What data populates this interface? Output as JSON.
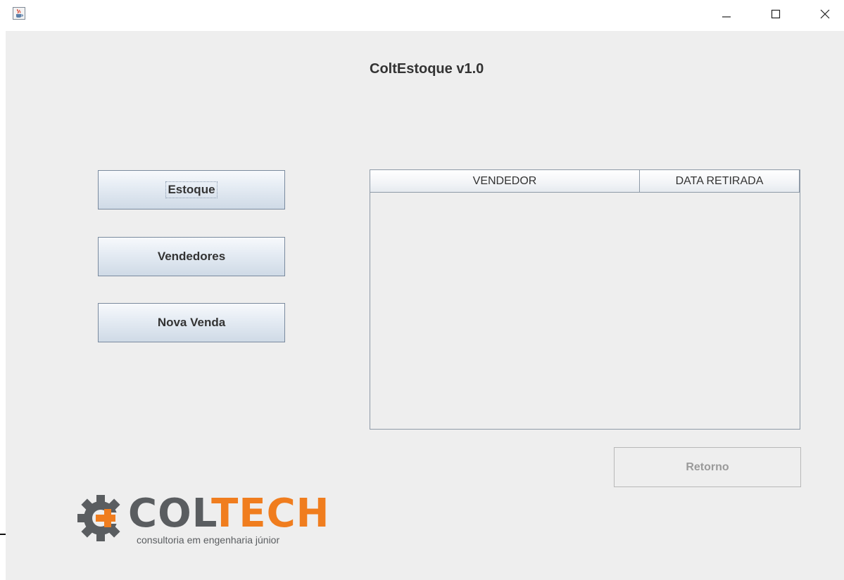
{
  "window": {
    "controls": {
      "minimize_icon": "minimize-icon",
      "maximize_icon": "maximize-icon",
      "close_icon": "close-icon"
    },
    "app_icon": "java-cup-icon"
  },
  "app": {
    "title": "ColtEstoque v1.0"
  },
  "nav": {
    "estoque_label": "Estoque",
    "vendedores_label": "Vendedores",
    "nova_venda_label": "Nova Venda"
  },
  "table": {
    "columns": [
      "VENDEDOR",
      "DATA RETIRADA"
    ],
    "rows": []
  },
  "footer": {
    "retorno_label": "Retorno"
  },
  "logo": {
    "word_left": "COL",
    "word_right": "TECH",
    "subtitle": "consultoria em engenharia júnior",
    "colors": {
      "gray": "#5a5d60",
      "orange": "#f07d1e"
    }
  }
}
